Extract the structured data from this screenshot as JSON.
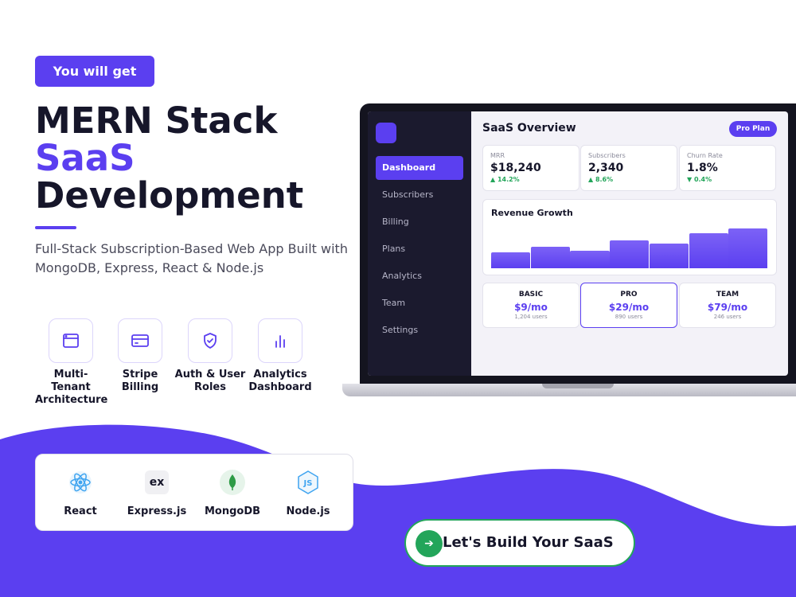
{
  "badge": "You will get",
  "headline": {
    "line1": "MERN Stack",
    "line2": "SaaS",
    "line3": "Development"
  },
  "subtitle": "Full-Stack Subscription-Based Web App Built with MongoDB, Express, React & Node.js",
  "features": [
    {
      "icon": "browser-window-icon",
      "label": "Multi-Tenant Architecture"
    },
    {
      "icon": "credit-card-icon",
      "label": "Stripe Billing"
    },
    {
      "icon": "shield-check-icon",
      "label": "Auth & User Roles"
    },
    {
      "icon": "bar-chart-icon",
      "label": "Analytics Dashboard"
    }
  ],
  "tech_stack": [
    {
      "icon": "react-atom-icon",
      "label": "React"
    },
    {
      "icon": "express-icon",
      "icon_text": "ex",
      "label": "Express.js"
    },
    {
      "icon": "mongodb-leaf-icon",
      "label": "MongoDB"
    },
    {
      "icon": "nodejs-hexagon-icon",
      "icon_text": "JS",
      "label": "Node.js"
    }
  ],
  "cta": {
    "label": "Let's Build Your SaaS",
    "icon": "arrow-right-icon"
  },
  "dashboard": {
    "title": "SaaS Overview",
    "plan_badge": "Pro Plan",
    "nav": [
      "Dashboard",
      "Subscribers",
      "Billing",
      "Plans",
      "Analytics",
      "Team",
      "Settings"
    ],
    "active_nav": "Dashboard",
    "stats": [
      {
        "label": "MRR",
        "value": "$18,240",
        "change": "▲ 14.2%",
        "trend": "up"
      },
      {
        "label": "Subscribers",
        "value": "2,340",
        "change": "▲ 8.6%",
        "trend": "up"
      },
      {
        "label": "Churn Rate",
        "value": "1.8%",
        "change": "▼ 0.4%",
        "trend": "down"
      }
    ],
    "revenue_chart": {
      "title": "Revenue Growth",
      "type": "bar",
      "values": [
        20,
        27,
        22,
        35,
        31,
        44,
        50
      ],
      "ylim": [
        0,
        56
      ]
    },
    "plans": [
      {
        "name": "BASIC",
        "price": "$9/mo",
        "users": "1,204 users",
        "featured": false
      },
      {
        "name": "PRO",
        "price": "$29/mo",
        "users": "890 users",
        "featured": true
      },
      {
        "name": "TEAM",
        "price": "$79/mo",
        "users": "246 users",
        "featured": false
      }
    ]
  },
  "colors": {
    "accent": "#5b3ff0",
    "dark": "#16162a",
    "sidebar": "#1b1a2e",
    "success": "#23a55a"
  }
}
